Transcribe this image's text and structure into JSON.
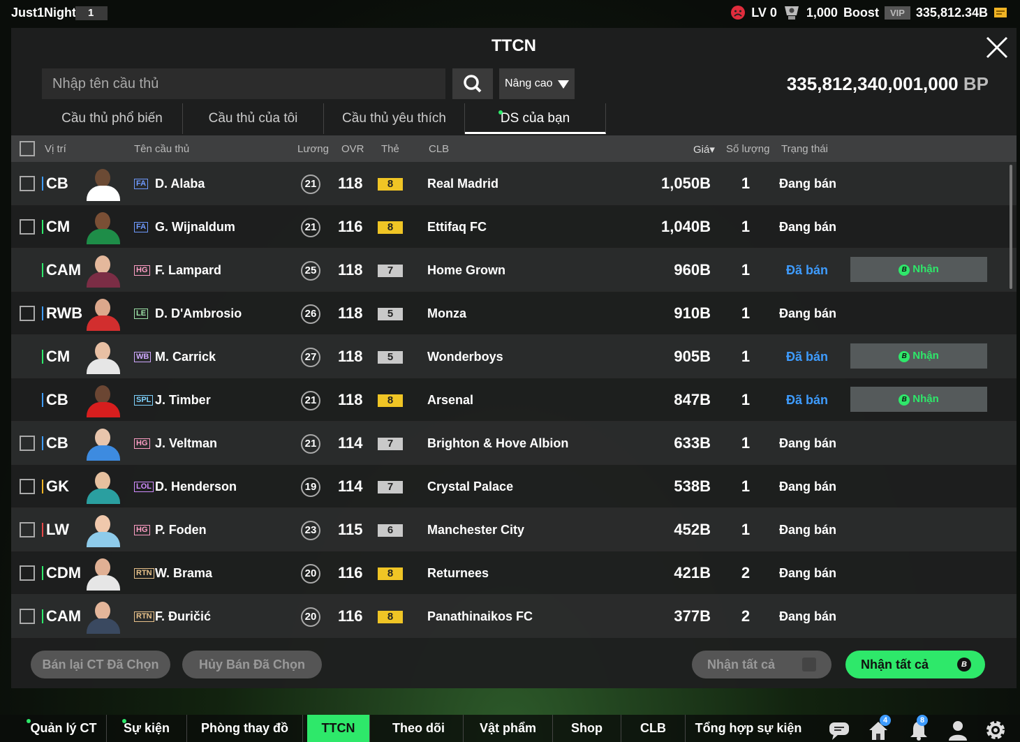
{
  "top": {
    "username": "Just1Night",
    "user_badge": "1",
    "level": "LV 0",
    "trophies": "1,000",
    "boost": "Boost",
    "vip": "VIP",
    "balance": "335,812.34B"
  },
  "panel": {
    "title": "TTCN",
    "search_placeholder": "Nhập tên cầu thủ",
    "advanced": "Nâng cao",
    "bp_value": "335,812,340,001,000",
    "bp_unit": "BP"
  },
  "tabs": [
    "Cầu thủ phổ biến",
    "Cầu thủ của tôi",
    "Cầu thủ yêu thích",
    "DS của bạn"
  ],
  "headers": {
    "pos": "Vị trí",
    "name": "Tên cầu thủ",
    "salary": "Lương",
    "ovr": "OVR",
    "grade": "Thẻ",
    "club": "CLB",
    "price": "Giá▾",
    "qty": "Số lượng",
    "status": "Trạng thái"
  },
  "claim_label": "Nhận",
  "rows": [
    {
      "pos": "CB",
      "season": "FA",
      "name": "D. Alaba",
      "salary": "21",
      "ovr": "118",
      "grade": "8",
      "club": "Real Madrid",
      "price": "1,050B",
      "qty": "1",
      "status": "Đang bán"
    },
    {
      "pos": "CM",
      "season": "FA",
      "name": "G. Wijnaldum",
      "salary": "21",
      "ovr": "116",
      "grade": "8",
      "club": "Ettifaq FC",
      "price": "1,040B",
      "qty": "1",
      "status": "Đang bán"
    },
    {
      "pos": "CAM",
      "season": "HG",
      "name": "F. Lampard",
      "salary": "25",
      "ovr": "118",
      "grade": "7",
      "club": "Home Grown",
      "price": "960B",
      "qty": "1",
      "status": "Đã bán"
    },
    {
      "pos": "RWB",
      "season": "LE",
      "name": "D. D'Ambrosio",
      "salary": "26",
      "ovr": "118",
      "grade": "5",
      "club": "Monza",
      "price": "910B",
      "qty": "1",
      "status": "Đang bán"
    },
    {
      "pos": "CM",
      "season": "WB",
      "name": "M. Carrick",
      "salary": "27",
      "ovr": "118",
      "grade": "5",
      "club": "Wonderboys",
      "price": "905B",
      "qty": "1",
      "status": "Đã bán"
    },
    {
      "pos": "CB",
      "season": "SPL",
      "name": "J. Timber",
      "salary": "21",
      "ovr": "118",
      "grade": "8",
      "club": "Arsenal",
      "price": "847B",
      "qty": "1",
      "status": "Đã bán"
    },
    {
      "pos": "CB",
      "season": "HG",
      "name": "J. Veltman",
      "salary": "21",
      "ovr": "114",
      "grade": "7",
      "club": "Brighton & Hove Albion",
      "price": "633B",
      "qty": "1",
      "status": "Đang bán"
    },
    {
      "pos": "GK",
      "season": "LOL",
      "name": "D. Henderson",
      "salary": "19",
      "ovr": "114",
      "grade": "7",
      "club": "Crystal Palace",
      "price": "538B",
      "qty": "1",
      "status": "Đang bán"
    },
    {
      "pos": "LW",
      "season": "HG",
      "name": "P. Foden",
      "salary": "23",
      "ovr": "115",
      "grade": "6",
      "club": "Manchester City",
      "price": "452B",
      "qty": "1",
      "status": "Đang bán"
    },
    {
      "pos": "CDM",
      "season": "RTN",
      "name": "W. Brama",
      "salary": "20",
      "ovr": "116",
      "grade": "8",
      "club": "Returnees",
      "price": "421B",
      "qty": "2",
      "status": "Đang bán"
    },
    {
      "pos": "CAM",
      "season": "RTN",
      "name": "F. Đuričić",
      "salary": "20",
      "ovr": "116",
      "grade": "8",
      "club": "Panathinaikos FC",
      "price": "377B",
      "qty": "2",
      "status": "Đang bán"
    }
  ],
  "buttons": {
    "resell": "Bán lại CT Đã Chọn",
    "cancel": "Hủy Bán Đã Chọn",
    "claim_all_gray": "Nhận tất cả",
    "claim_all_green": "Nhận tất cả"
  },
  "nav": [
    "Quản lý CT",
    "Sự kiện",
    "Phòng thay đồ",
    "TTCN",
    "Theo dõi",
    "Vật phẩm",
    "Shop",
    "CLB",
    "Tổng hợp sự kiện"
  ],
  "badges": {
    "home": "4",
    "bell": "8"
  }
}
